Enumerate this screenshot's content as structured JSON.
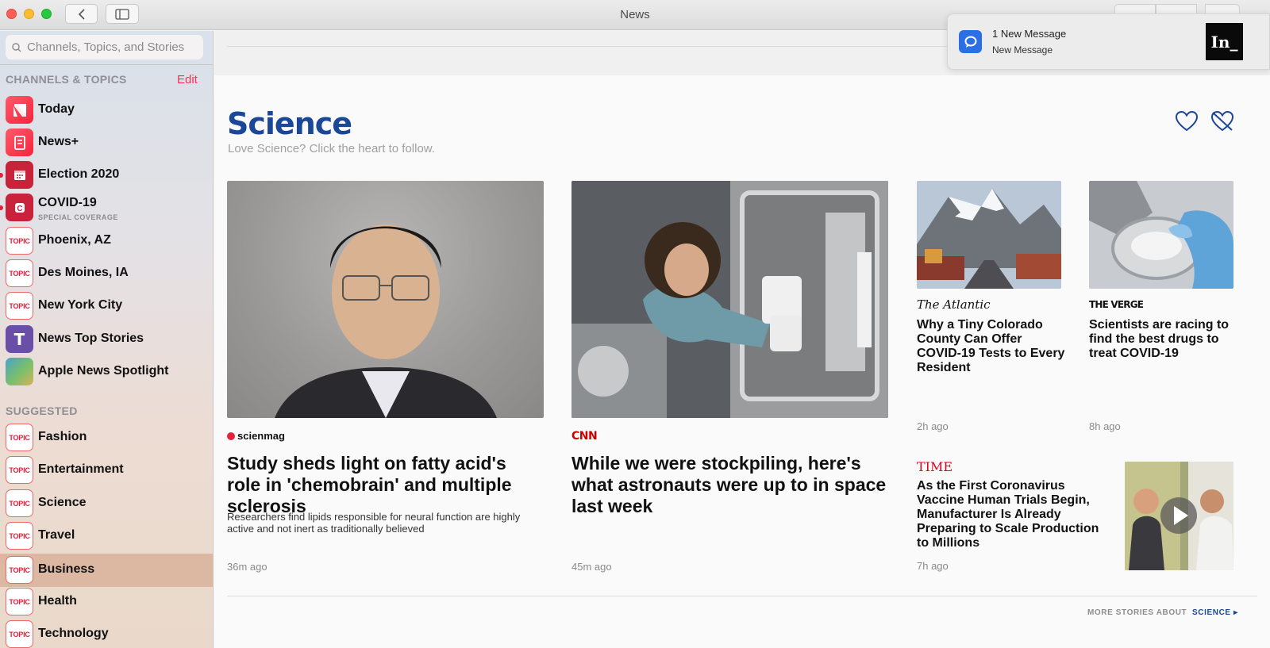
{
  "window": {
    "title": "News"
  },
  "search": {
    "placeholder": "Channels, Topics, and Stories"
  },
  "sidebar": {
    "channels_header": "CHANNELS & TOPICS",
    "edit_label": "Edit",
    "channels": [
      {
        "label": "Today",
        "icon": "apple-news-icon",
        "color": "#fc3c44"
      },
      {
        "label": "News+",
        "icon": "news-plus-icon",
        "color": "#fc3c44"
      },
      {
        "label": "Election 2020",
        "icon": "ballot-icon",
        "color": "#d8283c"
      },
      {
        "label": "COVID-19",
        "sub": "SPECIAL COVERAGE",
        "icon": "covid-icon",
        "color": "#d8283c"
      },
      {
        "label": "Phoenix, AZ",
        "badge": "TOPIC"
      },
      {
        "label": "Des Moines, IA",
        "badge": "TOPIC"
      },
      {
        "label": "New York City",
        "badge": "TOPIC"
      },
      {
        "label": "News Top Stories",
        "icon_letter": "T",
        "color": "#6a4fa8"
      },
      {
        "label": "Apple News Spotlight",
        "icon": "spotlight-icon"
      }
    ],
    "suggested_header": "SUGGESTED",
    "suggested": [
      {
        "label": "Fashion",
        "badge": "TOPIC"
      },
      {
        "label": "Entertainment",
        "badge": "TOPIC"
      },
      {
        "label": "Science",
        "badge": "TOPIC"
      },
      {
        "label": "Travel",
        "badge": "TOPIC"
      },
      {
        "label": "Business",
        "badge": "TOPIC"
      },
      {
        "label": "Health",
        "badge": "TOPIC"
      },
      {
        "label": "Technology",
        "badge": "TOPIC"
      }
    ]
  },
  "main": {
    "title": "Science",
    "subtitle": "Love Science? Click the heart to follow.",
    "stories": [
      {
        "source": "scienmag",
        "headline": "Study sheds light on fatty acid's role in 'chemobrain' and multiple sclerosis",
        "description": "Researchers find lipids responsible for neural function are highly active and not inert as traditionally believed",
        "time": "36m ago"
      },
      {
        "source": "CNN",
        "headline": "While we were stockpiling, here's what astronauts were up to in space last week",
        "time": "45m ago"
      },
      {
        "source": "The Atlantic",
        "headline": "Why a Tiny Colorado County Can Offer COVID-19 Tests to Every Resident",
        "time": "2h ago"
      },
      {
        "source": "THE VERGE",
        "headline": "Scientists are racing to find the best drugs to treat COVID-19",
        "time": "8h ago"
      },
      {
        "source": "TIME",
        "headline": "As the First Coronavirus Vaccine Human Trials Begin, Manufacturer Is Already Preparing to Scale Production to Millions",
        "time": "7h ago"
      }
    ],
    "more_prefix": "MORE STORIES ABOUT",
    "more_topic": "SCIENCE"
  },
  "notification": {
    "title": "1 New Message",
    "body": "New Message",
    "app_icon": "message-bubble-icon",
    "logo_text": "In_"
  },
  "colors": {
    "accent": "#ff2d55",
    "science_blue": "#1b4797",
    "topic_red": "#e0203a"
  }
}
